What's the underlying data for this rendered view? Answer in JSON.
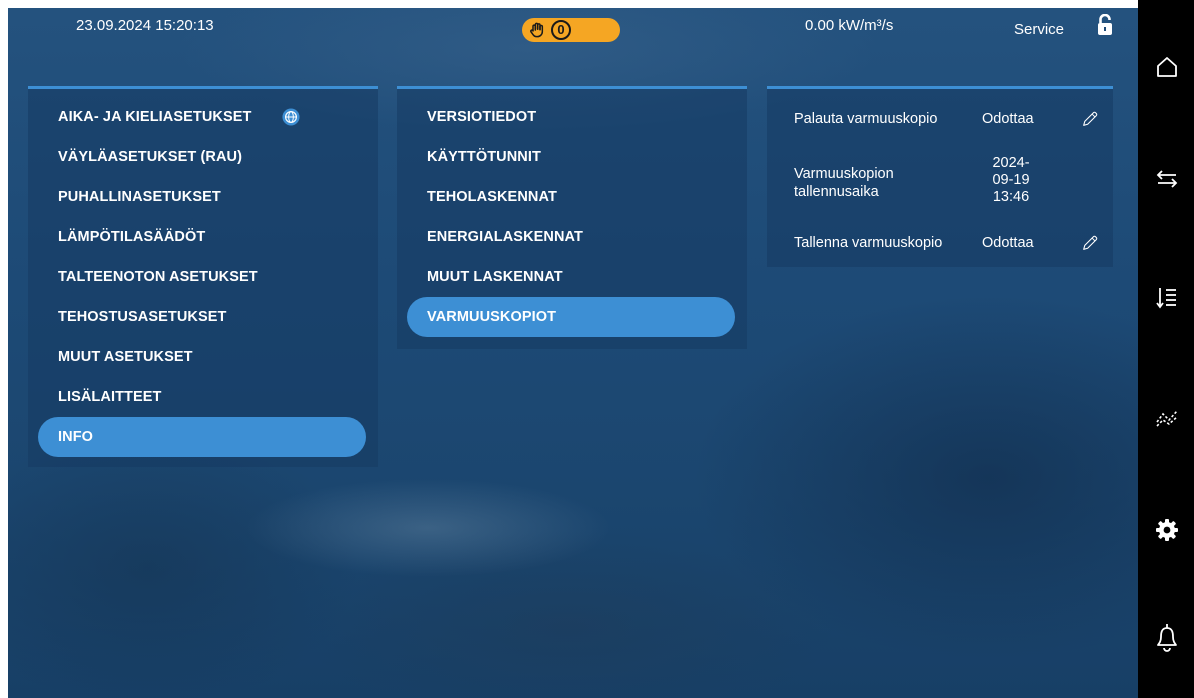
{
  "header": {
    "datetime": "23.09.2024 15:20:13",
    "manual_count": "0",
    "airflow": "0.00 kW/m³/s",
    "user_level": "Service"
  },
  "colors": {
    "accent": "#3d8fd4",
    "alarm_pill": "#f5a623",
    "background": "#1d4a76",
    "sidebar": "#000000"
  },
  "menu": {
    "items": [
      {
        "label": "AIKA- JA KIELIASETUKSET",
        "icon": "globe-icon"
      },
      {
        "label": "VÄYLÄASETUKSET (RAU)"
      },
      {
        "label": "PUHALLINASETUKSET"
      },
      {
        "label": "LÄMPÖTILASÄÄDÖT"
      },
      {
        "label": "TALTEENOTON ASETUKSET"
      },
      {
        "label": "TEHOSTUSASETUKSET"
      },
      {
        "label": "MUUT ASETUKSET"
      },
      {
        "label": "LISÄLAITTEET"
      },
      {
        "label": "INFO",
        "selected": true
      }
    ]
  },
  "submenu": {
    "items": [
      {
        "label": "VERSIOTIEDOT"
      },
      {
        "label": "KÄYTTÖTUNNIT"
      },
      {
        "label": "TEHOLASKENNAT"
      },
      {
        "label": "ENERGIALASKENNAT"
      },
      {
        "label": "MUUT LASKENNAT"
      },
      {
        "label": "VARMUUSKOPIOT",
        "selected": true
      }
    ]
  },
  "details": {
    "rows": [
      {
        "label": "Palauta varmuuskopio",
        "value": "Odottaa",
        "editable": true
      },
      {
        "label_line1": "Varmuuskopion",
        "label_line2": "tallennusaika",
        "value_line1": "2024-",
        "value_line2": "09-19",
        "value_line3": "13:46",
        "editable": false
      },
      {
        "label": "Tallenna varmuuskopio",
        "value": "Odottaa",
        "editable": true
      }
    ]
  },
  "sidebar": {
    "buttons": [
      "home-icon",
      "transfer-icon",
      "sort-list-icon",
      "trend-icon",
      "settings-gear-icon",
      "alarm-bell-icon"
    ]
  }
}
